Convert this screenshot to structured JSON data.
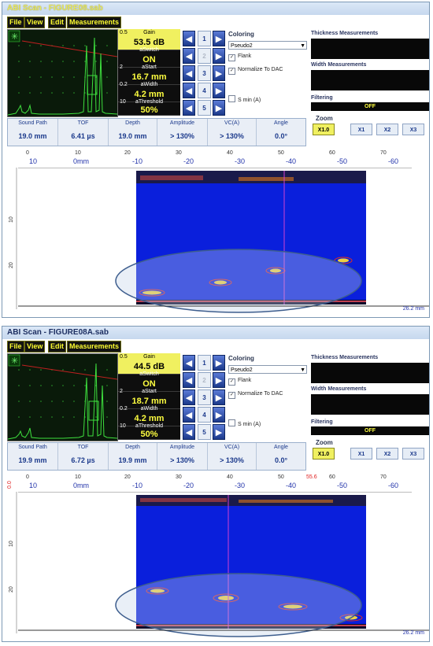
{
  "windows": [
    {
      "title": "ABI Scan - FIGURE08.sab",
      "menu": [
        "File",
        "View",
        "Edit",
        "Measurements"
      ],
      "params": [
        {
          "num": "0.5",
          "label": "Gain",
          "value": "53.5 dB",
          "highlighted": true
        },
        {
          "num": "",
          "label": "aSwitch",
          "value": "ON",
          "highlighted": false
        },
        {
          "num": "2",
          "label": "aStart",
          "value": "16.7 mm",
          "highlighted": false
        },
        {
          "num": "0.2",
          "label": "aWidth",
          "value": "4.2 mm",
          "highlighted": false
        },
        {
          "num": "10",
          "label": "aThreshold",
          "value": "50%",
          "highlighted": false
        }
      ],
      "ctl_numbers": [
        "1",
        "2",
        "3",
        "4",
        "5"
      ],
      "coloring_label": "Coloring",
      "coloring_value": "Pseudo2",
      "flank_label": "Flank",
      "normalize_label": "Normalize To DAC",
      "smin_label": "S min (A)",
      "thickness_label": "Thickness Measurements",
      "width_label": "Width Measurements",
      "filtering_label": "Filtering",
      "filtering_value": "OFF",
      "zoom_label": "Zoom",
      "zoom_buttons": [
        "X1.0",
        "X1",
        "X2",
        "X3"
      ],
      "measure_headers": [
        "Sound Path",
        "TOF",
        "Depth",
        "Amplitude",
        "VC(A)",
        "Angle"
      ],
      "measure_values": [
        "19.0 mm",
        "6.41 µs",
        "19.0 mm",
        "> 130%",
        "> 130%",
        "0.0°"
      ],
      "scale_top": [
        "0",
        "10",
        "20",
        "30",
        "40",
        "50",
        "60",
        "70"
      ],
      "scale_bottom": [
        "10",
        "0mm",
        "-10",
        "-20",
        "-30",
        "-40",
        "-50",
        "-60"
      ],
      "scale_left": [
        "10",
        "20"
      ],
      "red_marker": "",
      "left_red": "",
      "footer": "26.2 mm"
    },
    {
      "title": "ABI Scan - FIGURE08A.sab",
      "menu": [
        "File",
        "View",
        "Edit",
        "Measurements"
      ],
      "params": [
        {
          "num": "0.5",
          "label": "Gain",
          "value": "44.5 dB",
          "highlighted": true
        },
        {
          "num": "",
          "label": "aSwitch",
          "value": "ON",
          "highlighted": false
        },
        {
          "num": "2",
          "label": "aStart",
          "value": "18.7 mm",
          "highlighted": false
        },
        {
          "num": "0.2",
          "label": "aWidth",
          "value": "4.2 mm",
          "highlighted": false
        },
        {
          "num": "10",
          "label": "aThreshold",
          "value": "50%",
          "highlighted": false
        }
      ],
      "ctl_numbers": [
        "1",
        "2",
        "3",
        "4",
        "5"
      ],
      "coloring_label": "Coloring",
      "coloring_value": "Pseudo2",
      "flank_label": "Flank",
      "normalize_label": "Normalize To DAC",
      "smin_label": "S min (A)",
      "thickness_label": "Thickness Measurements",
      "width_label": "Width Measurements",
      "filtering_label": "Filtering",
      "filtering_value": "OFF",
      "zoom_label": "Zoom",
      "zoom_buttons": [
        "X1.0",
        "X1",
        "X2",
        "X3"
      ],
      "measure_headers": [
        "Sound Path",
        "TOF",
        "Depth",
        "Amplitude",
        "VC(A)",
        "Angle"
      ],
      "measure_values": [
        "19.9 mm",
        "6.72 µs",
        "19.9 mm",
        "> 130%",
        "> 130%",
        "0.0°"
      ],
      "scale_top": [
        "0",
        "10",
        "20",
        "30",
        "40",
        "50",
        "60",
        "70"
      ],
      "scale_bottom": [
        "10",
        "0mm",
        "-10",
        "-20",
        "-30",
        "-40",
        "-50",
        "-60"
      ],
      "scale_left": [
        "10",
        "20"
      ],
      "red_marker": "55.6",
      "left_red": "0.0",
      "footer": "26.2 mm"
    }
  ],
  "colors": {
    "accent_yellow": "#f0f060",
    "scan_blue": "#0a1fdc",
    "cursor_magenta": "#d040d0",
    "button_blue": "#1c3a8c"
  }
}
